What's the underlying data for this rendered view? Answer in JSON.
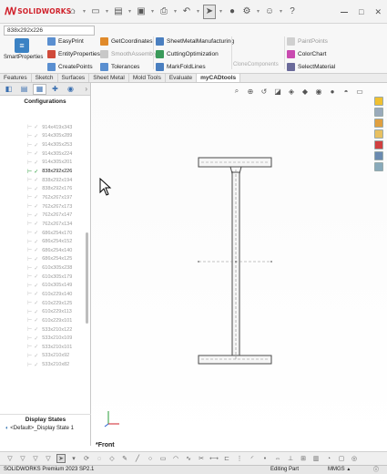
{
  "app": {
    "name": "SOLIDWORKS",
    "status_version": "SOLIDWORKS Premium 2023 SP2.1",
    "status_mode": "Editing Part",
    "units": "MMGS",
    "units_arrow": "▲"
  },
  "titlebar": {
    "icons": [
      "home-icon",
      "new-icon",
      "open-icon",
      "save-icon",
      "print-icon",
      "undo-icon",
      "select-icon",
      "traffic-light-icon",
      "options-icon",
      "user-icon",
      "help-icon"
    ],
    "minimize": "–",
    "maximize": "□",
    "close": "✕"
  },
  "ribbon": {
    "dimension_field": "838x292x226",
    "smart_properties": "SmartProperties",
    "col1": [
      "EasyPrint",
      "EntityProperties",
      "CreatePoints"
    ],
    "col2": [
      "GetCoordinates",
      "SmoothAssembly",
      "Tolerances"
    ],
    "col3": [
      "SheetMetalManufacturing",
      "CuttingOptimization",
      "MarkFoldLines"
    ],
    "col4_top": "PaintPoints",
    "col4": [
      "ColorChart",
      "SelectMaterial"
    ],
    "clone_components": "CloneComponents"
  },
  "tabs": [
    "Features",
    "Sketch",
    "Surfaces",
    "Sheet Metal",
    "Mold Tools",
    "Evaluate",
    "myCADtools"
  ],
  "active_tab": "myCADtools",
  "left_panel": {
    "configurations_title": "Configurations",
    "active_config": "838x292x226",
    "configs": [
      "914x419x343",
      "914x305x289",
      "914x305x253",
      "914x305x224",
      "914x305x201",
      "838x292x226",
      "838x292x194",
      "838x292x176",
      "762x267x197",
      "762x267x173",
      "762x267x147",
      "762x267x134",
      "686x254x170",
      "686x254x152",
      "686x254x140",
      "686x254x125",
      "610x305x238",
      "610x305x179",
      "610x305x149",
      "610x229x140",
      "610x229x125",
      "610x229x113",
      "610x229x101",
      "533x210x122",
      "533x210x109",
      "533x210x101",
      "533x210x92",
      "533x210x82"
    ],
    "display_states_title": "Display States",
    "display_state": "<Default>_Display State 1"
  },
  "graphics": {
    "view_label": "*Front"
  },
  "colors": {
    "brand_red": "#d0202a",
    "active_green": "#2a9d3a",
    "beam_line": "#4a4a4a"
  }
}
